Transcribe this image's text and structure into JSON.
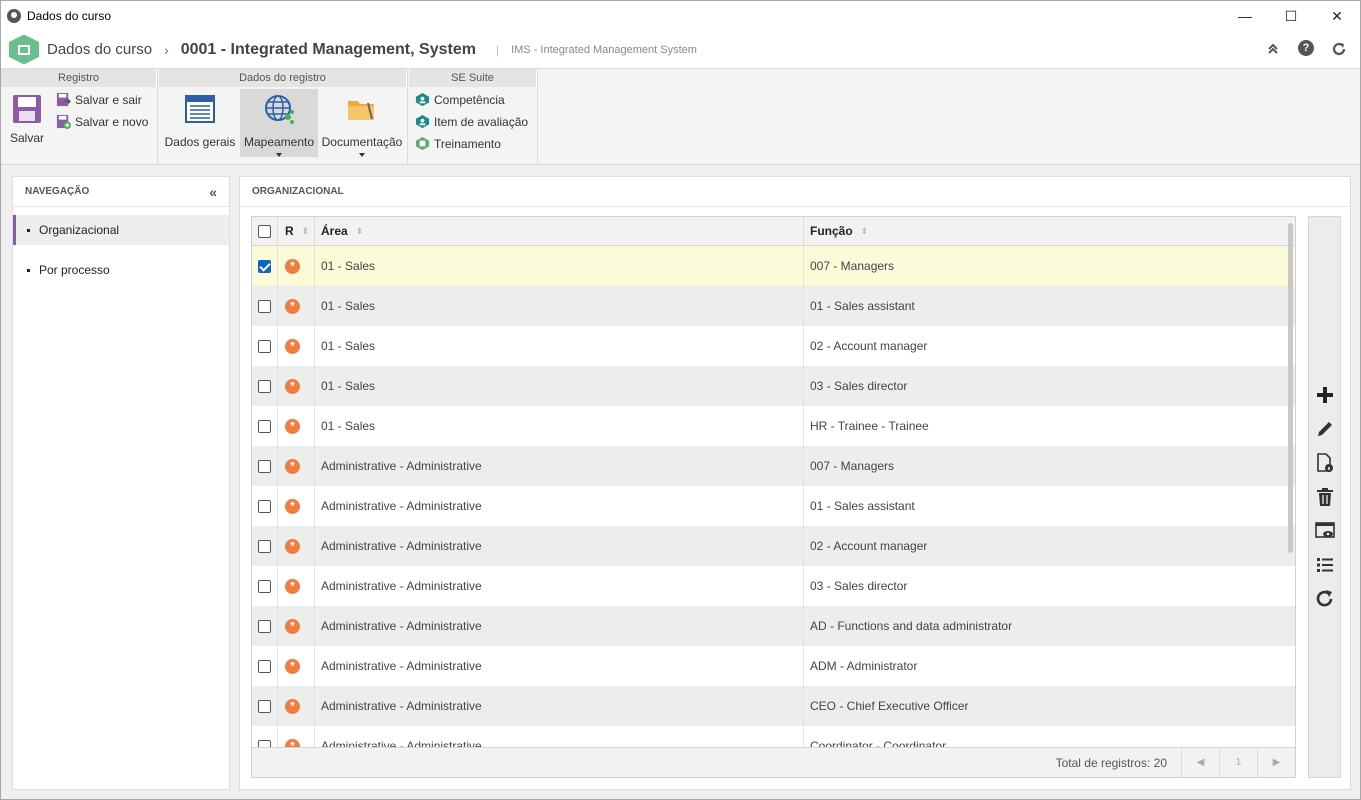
{
  "window": {
    "title": "Dados do curso",
    "minimize": "—",
    "maximize": "☐",
    "close": "✕"
  },
  "header": {
    "crumb_root": "Dados do curso",
    "crumb_sep": "›",
    "crumb_record": "0001 - Integrated Management, System",
    "crumb_pipe": "|",
    "crumb_sub": "IMS - Integrated Management System",
    "icons": [
      "collapse-up-icon",
      "help-icon",
      "refresh-icon"
    ]
  },
  "ribbon": {
    "registro": {
      "title": "Registro",
      "salvar": "Salvar",
      "salvar_sair": "Salvar e sair",
      "salvar_novo": "Salvar e novo"
    },
    "dados_registro": {
      "title": "Dados do registro",
      "dados_gerais": "Dados gerais",
      "mapeamento": "Mapeamento",
      "documentacao": "Documentação"
    },
    "se_suite": {
      "title": "SE Suite",
      "competencia": "Competência",
      "item_avaliacao": "Item de avaliação",
      "treinamento": "Treinamento"
    }
  },
  "nav": {
    "title": "NAVEGAÇÃO",
    "collapse": "«",
    "items": [
      {
        "label": "Organizacional",
        "active": true
      },
      {
        "label": "Por processo",
        "active": false
      }
    ]
  },
  "main": {
    "title": "ORGANIZACIONAL",
    "columns": {
      "r": "R",
      "area": "Área",
      "funcao": "Função"
    },
    "rows": [
      {
        "area": "01 - Sales",
        "funcao": "007 - Managers",
        "checked": true
      },
      {
        "area": "01 - Sales",
        "funcao": "01 - Sales assistant",
        "checked": false
      },
      {
        "area": "01 - Sales",
        "funcao": "02 - Account manager",
        "checked": false
      },
      {
        "area": "01 - Sales",
        "funcao": "03 - Sales director",
        "checked": false
      },
      {
        "area": "01 - Sales",
        "funcao": "HR - Trainee - Trainee",
        "checked": false
      },
      {
        "area": "Administrative - Administrative",
        "funcao": "007 - Managers",
        "checked": false
      },
      {
        "area": "Administrative - Administrative",
        "funcao": "01 - Sales assistant",
        "checked": false
      },
      {
        "area": "Administrative - Administrative",
        "funcao": "02 - Account manager",
        "checked": false
      },
      {
        "area": "Administrative - Administrative",
        "funcao": "03 - Sales director",
        "checked": false
      },
      {
        "area": "Administrative - Administrative",
        "funcao": "AD - Functions and data administrator",
        "checked": false
      },
      {
        "area": "Administrative - Administrative",
        "funcao": "ADM - Administrator",
        "checked": false
      },
      {
        "area": "Administrative - Administrative",
        "funcao": "CEO - Chief Executive Officer",
        "checked": false
      },
      {
        "area": "Administrative - Administrative",
        "funcao": "Coordinator - Coordinator",
        "checked": false
      }
    ],
    "footer": {
      "total": "Total de registros: 20",
      "page": "1",
      "prev": "◀",
      "next": "▶"
    },
    "tools": [
      "add-icon",
      "edit-icon",
      "document-info-icon",
      "delete-icon",
      "view-icon",
      "list-icon",
      "refresh-icon"
    ]
  },
  "colors": {
    "accent_purple": "#8a5ca5",
    "selected_row": "#fbfbd9",
    "role_icon": "#f07c3d",
    "checkbox": "#0a66c2"
  }
}
